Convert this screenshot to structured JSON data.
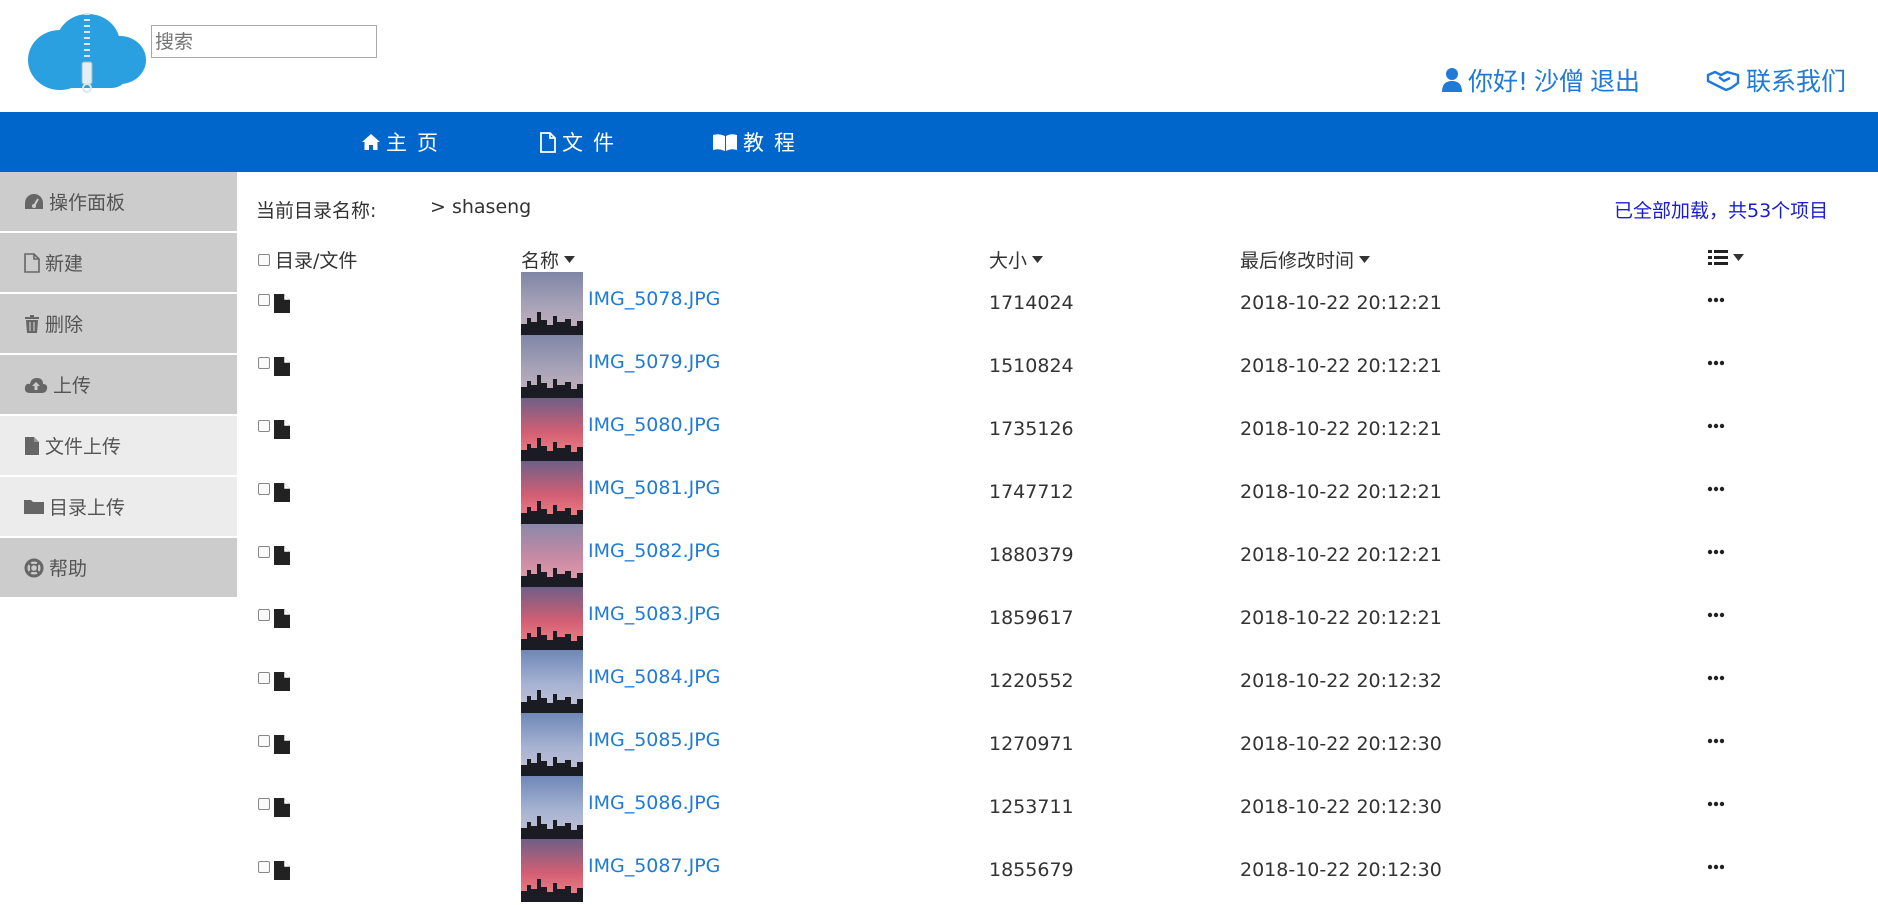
{
  "header": {
    "search_placeholder": "搜索",
    "greeting": "你好!",
    "username": "沙僧",
    "logout": "退出",
    "contact": "联系我们"
  },
  "nav": [
    {
      "label": "主页",
      "icon": "home-icon"
    },
    {
      "label": "文件",
      "icon": "file-icon"
    },
    {
      "label": "教程",
      "icon": "book-icon"
    }
  ],
  "sidebar": {
    "items": [
      {
        "label": "操作面板",
        "icon": "dashboard-icon"
      },
      {
        "label": "新建",
        "icon": "file-outline-icon"
      },
      {
        "label": "删除",
        "icon": "trash-icon"
      },
      {
        "label": "上传",
        "icon": "cloud-upload-icon"
      },
      {
        "label": "文件上传",
        "icon": "file-icon"
      },
      {
        "label": "目录上传",
        "icon": "folder-icon"
      },
      {
        "label": "帮助",
        "icon": "lifebuoy-icon"
      }
    ]
  },
  "main": {
    "crumb_label": "当前目录名称:",
    "crumb_path": "> shaseng",
    "load_status": "已全部加载，共53个项目",
    "columns": {
      "select": "目录/文件",
      "name": "名称",
      "size": "大小",
      "modified": "最后修改时间"
    },
    "rows": [
      {
        "name": "IMG_5078.JPG",
        "size": "1714024",
        "modified": "2018-10-22 20:12:21",
        "thumb": "dusk-grey"
      },
      {
        "name": "IMG_5079.JPG",
        "size": "1510824",
        "modified": "2018-10-22 20:12:21",
        "thumb": "dusk-grey"
      },
      {
        "name": "IMG_5080.JPG",
        "size": "1735126",
        "modified": "2018-10-22 20:12:21",
        "thumb": "sunset-red"
      },
      {
        "name": "IMG_5081.JPG",
        "size": "1747712",
        "modified": "2018-10-22 20:12:21",
        "thumb": "sunset-red"
      },
      {
        "name": "IMG_5082.JPG",
        "size": "1880379",
        "modified": "2018-10-22 20:12:21",
        "thumb": "sunset-pink"
      },
      {
        "name": "IMG_5083.JPG",
        "size": "1859617",
        "modified": "2018-10-22 20:12:21",
        "thumb": "sunset-red"
      },
      {
        "name": "IMG_5084.JPG",
        "size": "1220552",
        "modified": "2018-10-22 20:12:32",
        "thumb": "dusk-blue"
      },
      {
        "name": "IMG_5085.JPG",
        "size": "1270971",
        "modified": "2018-10-22 20:12:30",
        "thumb": "dusk-blue"
      },
      {
        "name": "IMG_5086.JPG",
        "size": "1253711",
        "modified": "2018-10-22 20:12:30",
        "thumb": "dusk-blue"
      },
      {
        "name": "IMG_5087.JPG",
        "size": "1855679",
        "modified": "2018-10-22 20:12:30",
        "thumb": "sunset-red"
      }
    ]
  },
  "colors": {
    "nav_bg": "#0066cc",
    "link": "#1f7ad8",
    "status": "#1a1adb",
    "sidebar_dark": "#cccccc",
    "sidebar_light": "#ececec"
  }
}
